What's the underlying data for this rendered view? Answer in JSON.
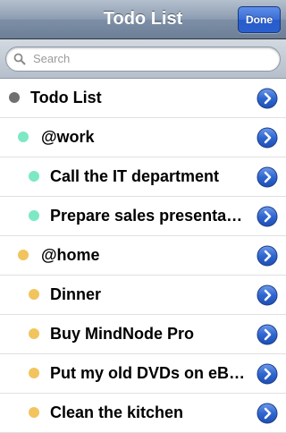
{
  "navbar": {
    "title": "Todo List",
    "done_label": "Done"
  },
  "search": {
    "placeholder": "Search"
  },
  "colors": {
    "root": "#707070",
    "work": "#7de8c4",
    "home": "#f2c45e",
    "accent": "#2a62cc"
  },
  "rows": [
    {
      "label": "Todo List",
      "level": 0,
      "dot_color": "#707070"
    },
    {
      "label": "@work",
      "level": 1,
      "dot_color": "#7de8c4"
    },
    {
      "label": "Call the IT department",
      "level": 2,
      "dot_color": "#7de8c4"
    },
    {
      "label": "Prepare sales presentation",
      "level": 2,
      "dot_color": "#7de8c4"
    },
    {
      "label": "@home",
      "level": 1,
      "dot_color": "#f2c45e"
    },
    {
      "label": "Dinner",
      "level": 2,
      "dot_color": "#f2c45e"
    },
    {
      "label": "Buy MindNode Pro",
      "level": 2,
      "dot_color": "#f2c45e"
    },
    {
      "label": "Put my old DVDs on eBay",
      "level": 2,
      "dot_color": "#f2c45e"
    },
    {
      "label": "Clean the kitchen",
      "level": 2,
      "dot_color": "#f2c45e"
    }
  ]
}
